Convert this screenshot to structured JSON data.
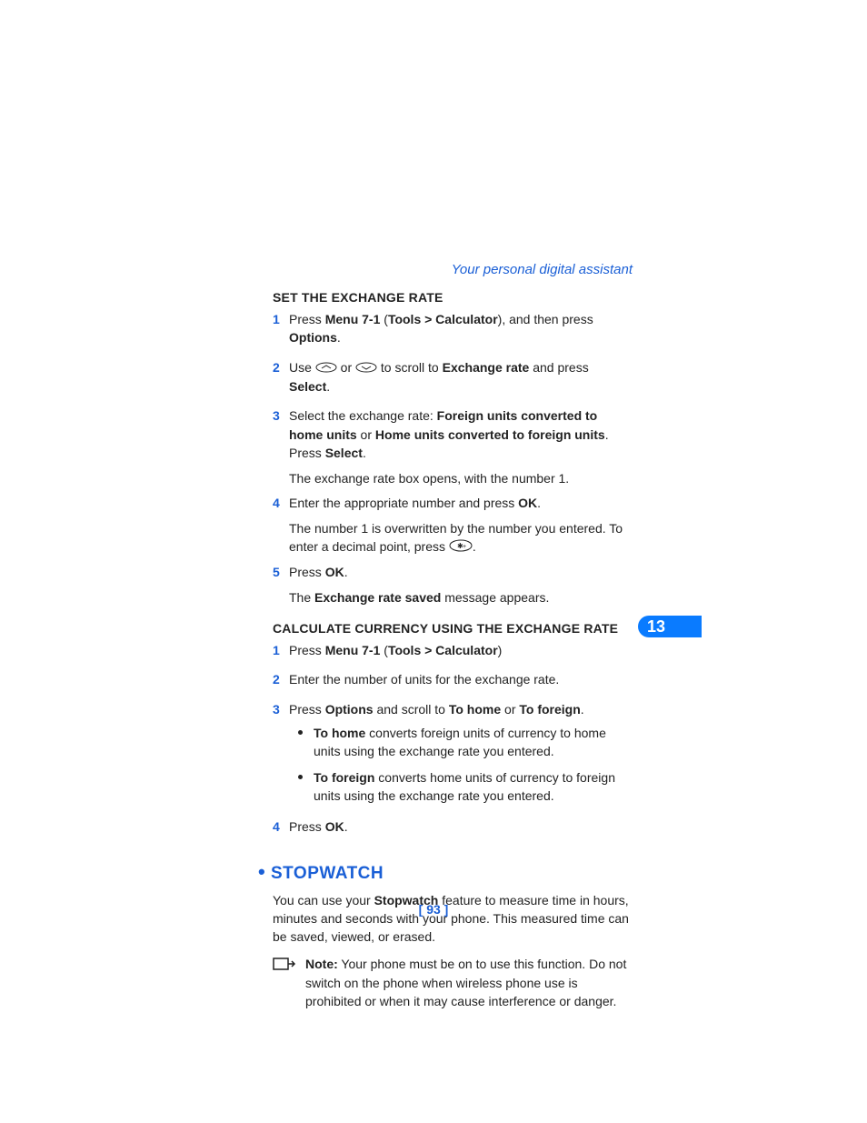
{
  "header": {
    "title": "Your personal digital assistant"
  },
  "section1": {
    "heading": "SET THE EXCHANGE RATE",
    "s1": {
      "n": "1",
      "a": "Press ",
      "b": "Menu 7-1",
      "c": " (",
      "d": "Tools > Calculator",
      "e": "), and then press ",
      "f": "Options",
      "g": "."
    },
    "s2": {
      "n": "2",
      "a": "Use ",
      "b": " or ",
      "c": " to scroll to ",
      "d": "Exchange rate",
      "e": " and press ",
      "f": "Select",
      "g": "."
    },
    "s3": {
      "n": "3",
      "a": "Select the exchange rate: ",
      "b": "Foreign units converted to home units",
      "c": " or ",
      "d": "Home units converted to foreign units",
      "e": ". Press ",
      "f": "Select",
      "g": ".",
      "follow": "The exchange rate box opens, with the number 1."
    },
    "s4": {
      "n": "4",
      "a": "Enter the appropriate number and press ",
      "b": "OK",
      "c": ".",
      "follow1": "The number 1 is overwritten by the number you entered. To enter a decimal point, press ",
      "follow2": "."
    },
    "s5": {
      "n": "5",
      "a": "Press ",
      "b": "OK",
      "c": ".",
      "follow1": "The ",
      "follow2": "Exchange rate saved",
      "follow3": " message appears."
    }
  },
  "section2": {
    "heading": "CALCULATE CURRENCY USING THE EXCHANGE RATE",
    "s1": {
      "n": "1",
      "a": "Press ",
      "b": "Menu 7-1",
      "c": " (",
      "d": "Tools > Calculator",
      "e": ")"
    },
    "s2": {
      "n": "2",
      "a": "Enter the number of units for the exchange rate."
    },
    "s3": {
      "n": "3",
      "a": "Press ",
      "b": "Options",
      "c": " and scroll to ",
      "d": "To home",
      "e": " or ",
      "f": "To foreign",
      "g": ".",
      "b1": {
        "a": "To home",
        "b": " converts foreign units of currency to home units using the exchange rate you entered."
      },
      "b2": {
        "a": "To foreign",
        "b": " converts home units of currency to foreign units using the exchange rate you entered."
      }
    },
    "s4": {
      "n": "4",
      "a": "Press ",
      "b": "OK",
      "c": "."
    }
  },
  "stopwatch": {
    "heading": "STOPWATCH",
    "p1a": "You can use your ",
    "p1b": "Stopwatch",
    "p1c": " feature to measure time in hours, minutes and seconds with your phone. This measured time can be saved, viewed, or erased.",
    "note_label": "Note:",
    "note_body": " Your phone must be on to use this function. Do not switch on the phone when wireless phone use is prohibited or when it may cause interference or danger."
  },
  "tab": "13",
  "page_number": "[ 93 ]"
}
